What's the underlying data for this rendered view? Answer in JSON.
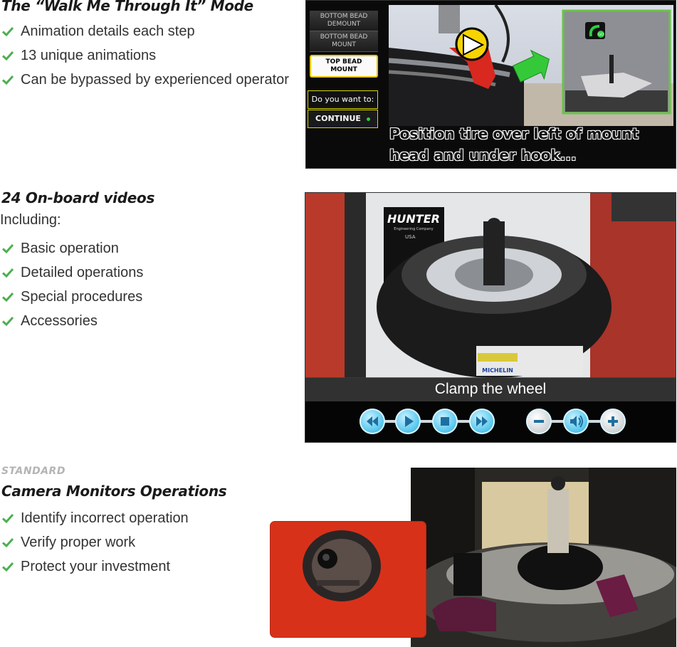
{
  "sections": [
    {
      "heading": "The “Walk Me Through It” Mode",
      "items": [
        "Animation details each step",
        "13 unique animations",
        "Can be bypassed by experienced operator"
      ]
    },
    {
      "heading": "24 On-board videos",
      "intro": "Including:",
      "items": [
        "Basic operation",
        "Detailed operations",
        "Special procedures",
        "Accessories"
      ]
    },
    {
      "eyebrow": "STANDARD",
      "heading": "Camera Monitors Operations",
      "items": [
        "Identify incorrect operation",
        "Verify proper work",
        "Protect your investment"
      ]
    }
  ],
  "animation_panel": {
    "menu": [
      "BOTTOM BEAD DEMOUNT",
      "BOTTOM BEAD MOUNT",
      "TOP BEAD MOUNT"
    ],
    "active_index": 2,
    "prompt": "Do you want to:",
    "continue_label": "CONTINUE",
    "caption": "Position tire over left of mount head and under hook...",
    "go_label": "GO"
  },
  "video_panel": {
    "caption": "Clamp the wheel",
    "brand": "HUNTER",
    "brand_sub": "Engineering Company",
    "made_in": "USA",
    "tire_brand": "MICHELIN",
    "controls": [
      "rewind",
      "play",
      "stop",
      "fast-forward",
      "volume-down",
      "volume",
      "volume-up"
    ]
  },
  "colors": {
    "check": "#4caf50",
    "heading": "#1a1a1a",
    "eyebrow": "#b4b4b4",
    "highlight_border": "#e5c300",
    "control_blue": "#5ac8ee"
  }
}
